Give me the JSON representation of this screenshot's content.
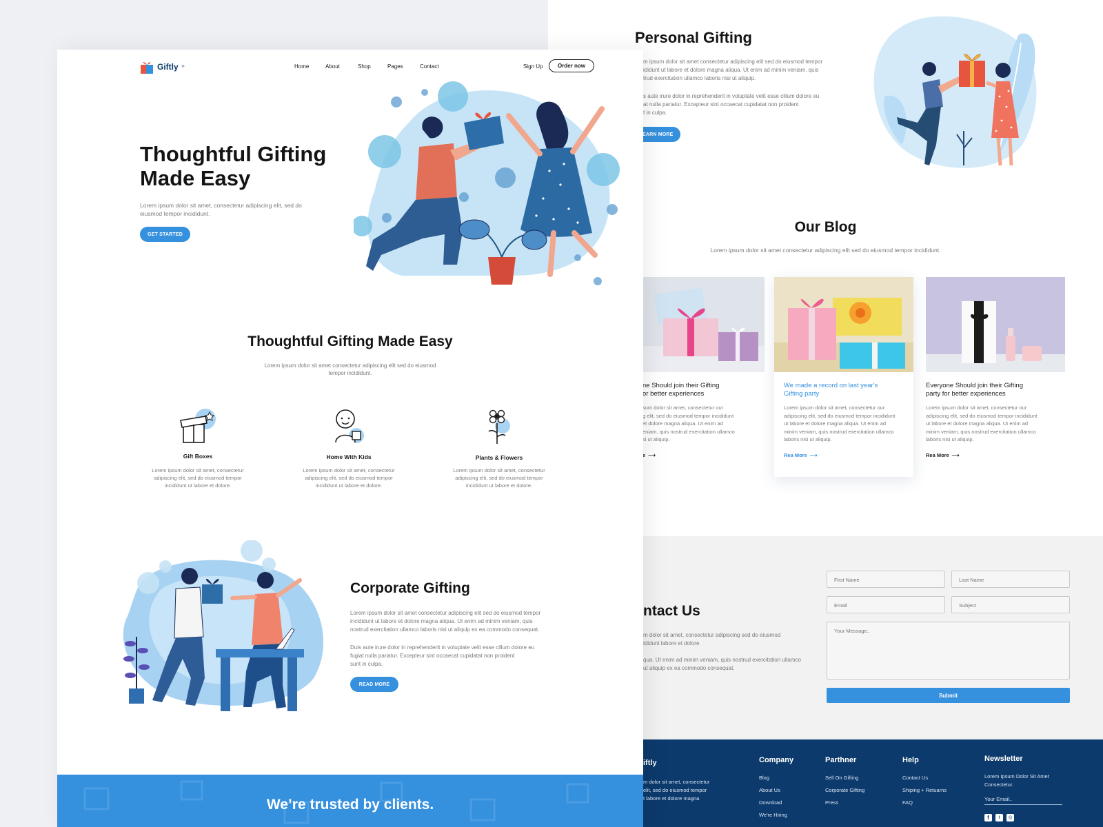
{
  "brand": {
    "name": "Giftly",
    "mark": "®"
  },
  "nav": {
    "items": [
      "Home",
      "About",
      "Shop",
      "Pages",
      "Contact"
    ],
    "signup": "Sign Up",
    "order": "Order now"
  },
  "hero": {
    "title_line1": "Thoughtful Gifting",
    "title_line2": "Made Easy",
    "text_line1": "Lorem ipsum dolor sit amet, consectetur adipiscing elit, sed do",
    "text_line2": "eiusmod tempor incididunt.",
    "cta": "GET STARTED"
  },
  "features": {
    "title": "Thoughtful Gifting Made Easy",
    "sub_line1": "Lorem ipsum dolor sit amet consectetur adipiscing elit sed do eiusmod",
    "sub_line2": "tempor incididunt.",
    "items": [
      {
        "title": "Gift Boxes",
        "icon": "gift-box-icon",
        "l1": "Lorem ipsum dolor sit amet, consectetur",
        "l2": "adipiscing elit, sed do eiusmod tempor",
        "l3": "incididunt ut labore et dolore."
      },
      {
        "title": "Home With Kids",
        "icon": "kid-icon",
        "l1": "Lorem ipsum dolor sit amet, consectetur",
        "l2": "adipiscing elit, sed do eiusmod tempor",
        "l3": "incididunt ut labore et dolore."
      },
      {
        "title": "Plants & Flowers",
        "icon": "flower-icon",
        "l1": "Lorem ipsum dolor sit amet, consectetur",
        "l2": "adipiscing elit, sed do eiusmod tempor",
        "l3": "incididunt ut labore et dolore."
      }
    ]
  },
  "corporate": {
    "title": "Corporate Gifting",
    "p1_l1": "Lorem ipsum dolor sit amet consectetur adipiscing elit sed do eiusmod tempor",
    "p1_l2": "incididunt ut labore et dolore magna aliqua. Ut enim ad minim veniam, quis",
    "p1_l3": "nostrud exercitation ullamco laboris nisi ut aliquip ex ea commodo consequat.",
    "p2_l1": "Duis aute irure dolor in reprehenderit in voluptate velit esse cillum dolore eu",
    "p2_l2": "fugiat nulla pariatur. Excepteur sint occaecat cupidatat non proident",
    "p2_l3": "sunt in culpa.",
    "cta": "READ MORE"
  },
  "trust": {
    "title": "We’re trusted by clients."
  },
  "personal": {
    "title": "Personal Gifting",
    "p1_l1": "m ipsum dolor sit amet consectetur adipiscing elit sed do eiusmod tempor",
    "p1_l2": "ididunt ut labore et dolore magna aliqua. Ut enim ad minim veniam, quis",
    "p1_l3": "trud exercitation ullamco laboris nisi ut aliquip.",
    "p2_l1": "s aute irure dolor in reprehenderit in voluptate velit esse cillum dolore eu",
    "p2_l2": "at nulla pariatur. Excepteur sint occaecat cupidatat non proident",
    "p2_l3": "t in culpa.",
    "cta": "LEARN MORE"
  },
  "blog": {
    "title": "Our Blog",
    "sub": "Lorem ipsum dolor sit amet consectetur adipiscing elit sed do eiusmod tempor incididunt.",
    "cards": [
      {
        "t1": "ne Should join their Gifting",
        "t2": "or better experiences",
        "x1": "sum dolor sit amet, consectetur our",
        "x2": "g elit, sed do eiusmod tempor incididunt",
        "x3": "et dolore magna aliqua. Ut enim ad",
        "x4": "eniam, quis nostrud exercitation ullamco",
        "x5": "si ut aliquip.",
        "more": "e"
      },
      {
        "t1": "We made a record on last year's",
        "t2": "Gifting party",
        "x1": "Lorem ipsum dolor sit amet, consectetur our",
        "x2": "adipiscing elit, sed do eiusmod tempor incididunt",
        "x3": "ut labore et dolore magna aliqua. Ut enim ad",
        "x4": "minim veniam, quis nostrud exercitation ullamco",
        "x5": "laboris nisi ut aliquip.",
        "more": "Rea More"
      },
      {
        "t1": "Everyone Should join their Gifting",
        "t2": "party for better experiences",
        "x1": "Lorem ipsum dolor sit amet, consectetur our",
        "x2": "adipiscing elit, sed do eiusmod tempor incididunt",
        "x3": "ut labore et dolore magna aliqua. Ut enim ad",
        "x4": "minim veniam, quis nostrud exercitation ullamco",
        "x5": "laboris nisi ut aliquip.",
        "more": "Rea More"
      }
    ]
  },
  "contact": {
    "title": "ntact Us",
    "l1": "m dolor sit amet, consectetur adipiscing sed do eiusmod",
    "l2": "ididunt labore et dolore",
    "l3": "qua. Ut enim ad minim veniam, quis nostrud exercitation ullamco",
    "l4": "ut aliquip ex ea commodo consequat.",
    "first_name": "First Name",
    "last_name": "Last Name",
    "email": "Email",
    "subject": "Subject",
    "message": "Your Message..",
    "submit": "Submit"
  },
  "footer": {
    "brand": "iftly",
    "about_l1": "m dolor sit amet, consectetur",
    "about_l2": "elit, sed do eiusmod tempor",
    "about_l3": "t labore et dolore magna",
    "company": {
      "title": "Company",
      "links": [
        "Blog",
        "About Us",
        "Download",
        "We're Hiring"
      ]
    },
    "partner": {
      "title": "Parthner",
      "links": [
        "Sell On Gifting",
        "Corporate Gifting",
        "Press"
      ]
    },
    "help": {
      "title": "Help",
      "links": [
        "Contact Us",
        "Shiping + Retuarns",
        "FAQ"
      ]
    },
    "newsletter": {
      "title": "Newsletter",
      "l1": "Lorem Ipsum Dolor Sit Amet",
      "l2": "Consectetur.",
      "email": "Your Email.."
    }
  },
  "colors": {
    "accent": "#3590de",
    "navy": "#0c3a6c",
    "light_blue": "#c7e4f7"
  }
}
